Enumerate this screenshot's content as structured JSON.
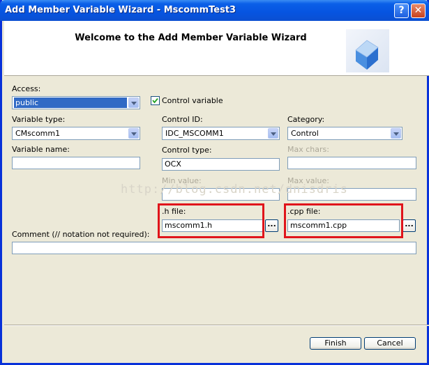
{
  "window": {
    "title": "Add Member Variable Wizard - MscommTest3"
  },
  "header": {
    "title": "Welcome to the Add Member Variable Wizard"
  },
  "form": {
    "access_label": "Access:",
    "access_value": "public",
    "control_variable_label": "Control variable",
    "control_variable_checked": true,
    "variable_type_label": "Variable type:",
    "variable_type_value": "CMscomm1",
    "control_id_label": "Control ID:",
    "control_id_value": "IDC_MSCOMM1",
    "category_label": "Category:",
    "category_value": "Control",
    "variable_name_label": "Variable name:",
    "variable_name_value": "",
    "control_type_label": "Control type:",
    "control_type_value": "OCX",
    "max_chars_label": "Max chars:",
    "max_chars_value": "",
    "min_value_label": "Min value:",
    "min_value_value": "",
    "max_value_label": "Max value:",
    "max_value_value": "",
    "h_file_label": ".h file:",
    "h_file_value": "mscomm1.h",
    "cpp_file_label": ".cpp file:",
    "cpp_file_value": "mscomm1.cpp",
    "browse_label": "...",
    "comment_label": "Comment (// notation not required):",
    "comment_value": ""
  },
  "watermark": "http://blog.csdn.net/dnisdris",
  "buttons": {
    "finish": "Finish",
    "cancel": "Cancel"
  },
  "icons": {
    "help": "help-icon",
    "close": "close-icon",
    "logo": "wizard-cube-icon"
  },
  "colors": {
    "title_bar": "#0a5fe8",
    "highlight_box": "#e0141b",
    "selection": "#316ac5"
  }
}
